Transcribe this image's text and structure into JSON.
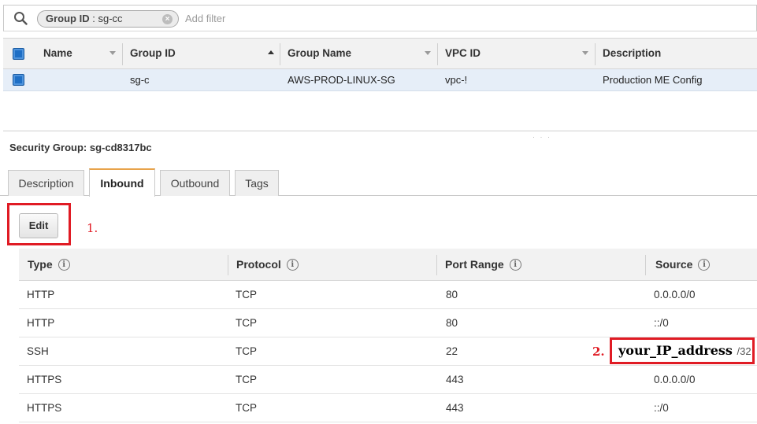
{
  "filter": {
    "chip_key": "Group ID",
    "chip_value": ": sg-cc",
    "chip_close": "×",
    "add_filter_placeholder": "Add filter"
  },
  "groups_table": {
    "columns": [
      "Name",
      "Group ID",
      "Group Name",
      "VPC ID",
      "Description"
    ],
    "rows": [
      {
        "selected": true,
        "name": "",
        "group_id": "sg-c",
        "group_name": "AWS-PROD-LINUX-SG",
        "vpc_id": "vpc-!",
        "description": "Production ME Config"
      }
    ]
  },
  "detail": {
    "title": "Security Group: sg-cd8317bc",
    "tabs": [
      {
        "label": "Description",
        "active": false
      },
      {
        "label": "Inbound",
        "active": true
      },
      {
        "label": "Outbound",
        "active": false
      },
      {
        "label": "Tags",
        "active": false
      }
    ],
    "edit_label": "Edit",
    "annotation_1": "1.",
    "annotation_2": "2."
  },
  "inbound_rules": {
    "columns": [
      "Type",
      "Protocol",
      "Port Range",
      "Source"
    ],
    "info_glyph": "i",
    "rows": [
      {
        "type": "HTTP",
        "protocol": "TCP",
        "port_range": "80",
        "source": "0.0.0.0/0"
      },
      {
        "type": "HTTP",
        "protocol": "TCP",
        "port_range": "80",
        "source": "::/0"
      },
      {
        "type": "SSH",
        "protocol": "TCP",
        "port_range": "22",
        "source": "",
        "source_ip": "your_IP_address",
        "source_cidr": "/32"
      },
      {
        "type": "HTTPS",
        "protocol": "TCP",
        "port_range": "443",
        "source": "0.0.0.0/0"
      },
      {
        "type": "HTTPS",
        "protocol": "TCP",
        "port_range": "443",
        "source": "::/0"
      }
    ]
  },
  "colors": {
    "annotation_red": "#e01b24",
    "checkbox_blue": "#1f6fc5",
    "active_tab_accent": "#e8a34a",
    "selected_row_bg": "#e6eef8"
  },
  "icons": {
    "search": "search-icon",
    "info": "info-icon",
    "close": "close-icon"
  }
}
